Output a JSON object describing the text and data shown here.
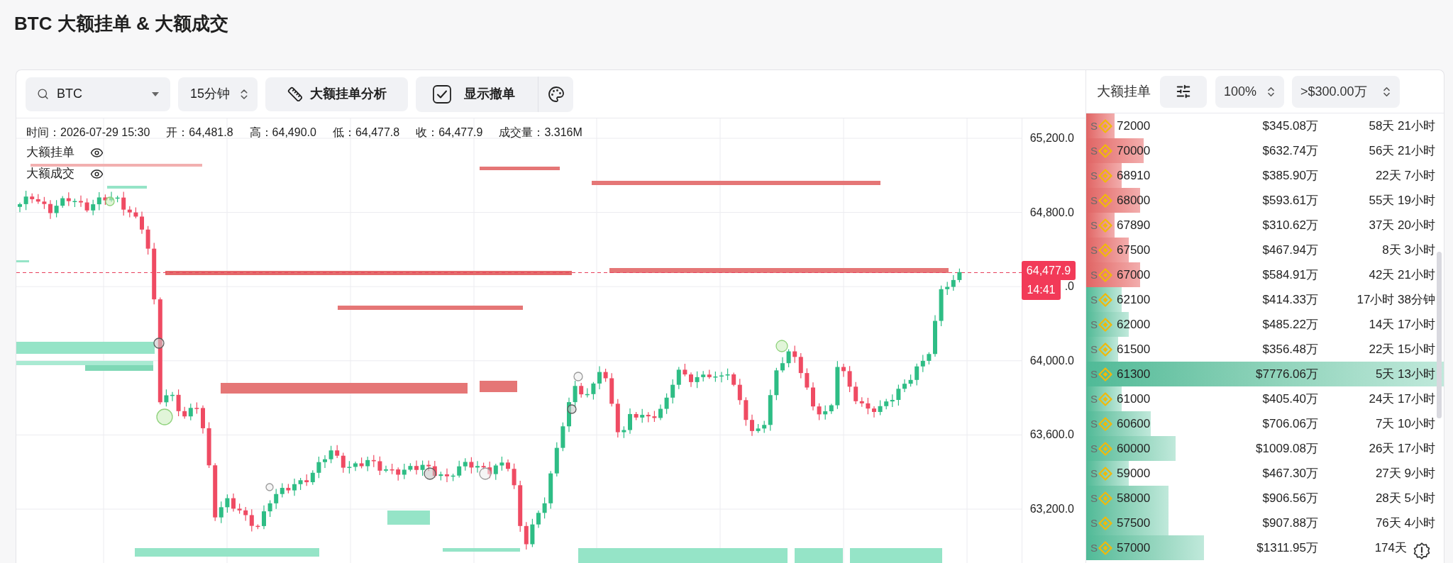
{
  "title": "BTC 大额挂单 & 大额成交",
  "toolbar": {
    "symbol": {
      "value": "BTC"
    },
    "interval": {
      "value": "15分钟"
    },
    "analysis": {
      "label": "大额挂单分析"
    },
    "show_cancelled": {
      "label": "显示撤单",
      "checked": true
    }
  },
  "chart": {
    "info": [
      "时间：2026-07-29 15:30",
      "开：64,481.8",
      "高：64,490.0",
      "低：64,477.8",
      "收：64,477.9",
      "成交量：3.316M"
    ],
    "legend": [
      {
        "label": "大额挂单",
        "visible": true
      },
      {
        "label": "大额成交",
        "visible": true
      }
    ],
    "price_axis": [
      "65,200.0",
      "64,800.0",
      ".0",
      "64,000.0",
      "63,600.0",
      "63,200.0"
    ],
    "last_price": {
      "price": "64,477.9",
      "countdown": "14:41"
    }
  },
  "order_panel": {
    "title": "大额挂单",
    "zoom": {
      "value": "100%"
    },
    "min_amount": {
      "value": ">$300.00万"
    },
    "rows": [
      {
        "kind": "ask",
        "tag": "S",
        "price": "72000",
        "amount": "$345.08万",
        "age": "58天 21小时",
        "level": 0.08
      },
      {
        "kind": "ask",
        "tag": "S",
        "price": "70000",
        "amount": "$632.74万",
        "age": "56天 21小时",
        "level": 0.16
      },
      {
        "kind": "ask",
        "tag": "S",
        "price": "68910",
        "amount": "$385.90万",
        "age": "22天 7小时",
        "level": 0.1
      },
      {
        "kind": "ask",
        "tag": "S",
        "price": "68000",
        "amount": "$593.61万",
        "age": "55天 19小时",
        "level": 0.15
      },
      {
        "kind": "ask",
        "tag": "S",
        "price": "67890",
        "amount": "$310.62万",
        "age": "37天 20小时",
        "level": 0.08
      },
      {
        "kind": "ask",
        "tag": "S",
        "price": "67500",
        "amount": "$467.94万",
        "age": "8天 3小时",
        "level": 0.12
      },
      {
        "kind": "ask",
        "tag": "S",
        "price": "67000",
        "amount": "$584.91万",
        "age": "42天 21小时",
        "level": 0.15
      },
      {
        "kind": "bid",
        "tag": "S",
        "price": "62100",
        "amount": "$414.33万",
        "age": "17小时 38分钟",
        "level": 0.1
      },
      {
        "kind": "bid",
        "tag": "S",
        "price": "62000",
        "amount": "$485.22万",
        "age": "14天 17小时",
        "level": 0.12
      },
      {
        "kind": "bid",
        "tag": "S",
        "price": "61500",
        "amount": "$356.48万",
        "age": "22天 15小时",
        "level": 0.09
      },
      {
        "kind": "bid",
        "tag": "S",
        "price": "61300",
        "amount": "$7776.06万",
        "age": "5天 13小时",
        "level": 1
      },
      {
        "kind": "bid",
        "tag": "S",
        "price": "61000",
        "amount": "$405.40万",
        "age": "24天 17小时",
        "level": 0.1
      },
      {
        "kind": "bid",
        "tag": "S",
        "price": "60600",
        "amount": "$706.06万",
        "age": "7天 10小时",
        "level": 0.18
      },
      {
        "kind": "bid",
        "tag": "S",
        "price": "60000",
        "amount": "$1009.08万",
        "age": "26天 17小时",
        "level": 0.25
      },
      {
        "kind": "bid",
        "tag": "S",
        "price": "59000",
        "amount": "$467.30万",
        "age": "27天 9小时",
        "level": 0.12
      },
      {
        "kind": "bid",
        "tag": "S",
        "price": "58000",
        "amount": "$906.56万",
        "age": "28天 5小时",
        "level": 0.23
      },
      {
        "kind": "bid",
        "tag": "S",
        "price": "57500",
        "amount": "$907.88万",
        "age": "76天 4小时",
        "level": 0.23
      },
      {
        "kind": "bid",
        "tag": "S",
        "price": "57000",
        "amount": "$1311.95万",
        "age": "174天",
        "level": 0.33
      }
    ]
  }
}
